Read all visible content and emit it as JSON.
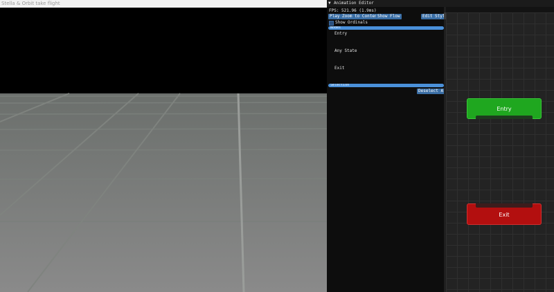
{
  "viewport": {
    "title": "Stella & Orbit take flight"
  },
  "editor": {
    "title": "Animation Editor",
    "fps_text": "FPS: 521.96 (1.9ms)",
    "toolbar": {
      "play": "Play",
      "zoom_to_content": "Zoom to Content",
      "show_flow": "Show Flow",
      "edit_style": "Edit Style"
    },
    "show_ordinals": {
      "label": "Show Ordinals",
      "checked": false
    },
    "nodes_section": {
      "title": "Nodes",
      "items": [
        "Entry",
        "Any State",
        "Exit"
      ]
    },
    "selection_section": {
      "title": "Selection",
      "deselect_all": "Deselect All"
    }
  },
  "graph": {
    "nodes": [
      {
        "label": "Entry",
        "color": "#1fa71f"
      },
      {
        "label": "Exit",
        "color": "#b30f0f"
      }
    ]
  }
}
